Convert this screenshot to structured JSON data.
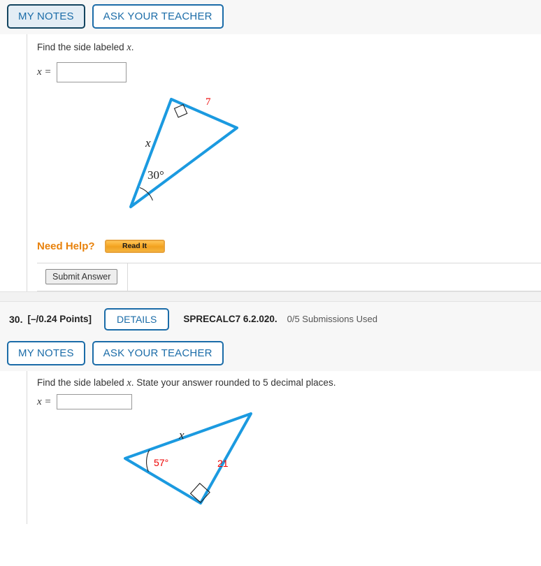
{
  "colors": {
    "link_blue": "#1b6ca8",
    "triangle_blue": "#1b9ae0",
    "label_red": "#ee0000",
    "need_help_orange": "#e8820c",
    "page_bg": "#ffffff",
    "band_bg": "#f7f7f7"
  },
  "question_29": {
    "buttons": {
      "my_notes": "MY NOTES",
      "ask_your_teacher": "ASK YOUR TEACHER"
    },
    "prompt_pre": "Find the side labeled ",
    "prompt_var": "x",
    "prompt_post": ".",
    "answer_label": "x =",
    "answer_value": "",
    "answer_placeholder": "",
    "need_help_label": "Need Help?",
    "read_it_label": "Read It",
    "submit_label": "Submit Answer",
    "figure": {
      "type": "triangle",
      "side_label": "7",
      "angle_label": "30°",
      "unknown_label": "x",
      "right_angle": true
    }
  },
  "question_30": {
    "number": "30.",
    "points": "[–/0.24 Points]",
    "details_label": "DETAILS",
    "code": "SPRECALC7 6.2.020.",
    "submissions": "0/5 Submissions Used",
    "buttons": {
      "my_notes": "MY NOTES",
      "ask_your_teacher": "ASK YOUR TEACHER"
    },
    "prompt_pre": "Find the side labeled ",
    "prompt_var": "x",
    "prompt_post": ". State your answer rounded to 5 decimal places.",
    "answer_label": "x =",
    "answer_value": "",
    "answer_placeholder": "",
    "figure": {
      "type": "triangle",
      "side_label": "21",
      "angle_label": "57°",
      "unknown_label": "x",
      "right_angle": true
    }
  }
}
